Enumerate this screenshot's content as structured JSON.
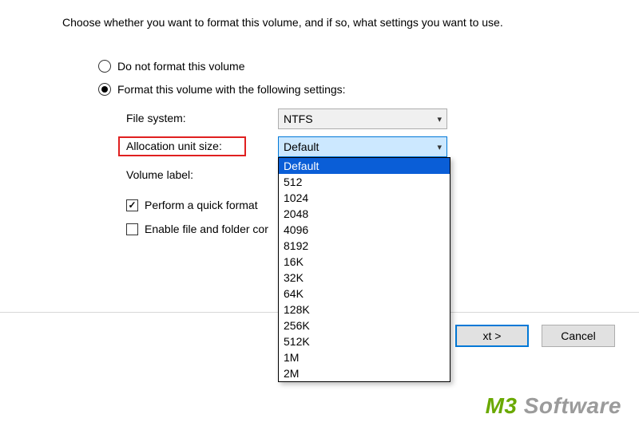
{
  "instruction": "Choose whether you want to format this volume, and if so, what settings you want to use.",
  "radios": {
    "no_format": "Do not format this volume",
    "format_with": "Format this volume with the following settings:"
  },
  "fields": {
    "file_system_label": "File system:",
    "file_system_value": "NTFS",
    "alloc_label": "Allocation unit size:",
    "alloc_value": "Default",
    "volume_label_label": "Volume label:"
  },
  "checks": {
    "quick_format": "Perform a quick format",
    "enable_compress": "Enable file and folder cor"
  },
  "alloc_options": [
    "Default",
    "512",
    "1024",
    "2048",
    "4096",
    "8192",
    "16K",
    "32K",
    "64K",
    "128K",
    "256K",
    "512K",
    "1M",
    "2M"
  ],
  "buttons": {
    "next": "xt >",
    "cancel": "Cancel"
  },
  "watermark": {
    "brand": "M3",
    "rest": " Software"
  }
}
